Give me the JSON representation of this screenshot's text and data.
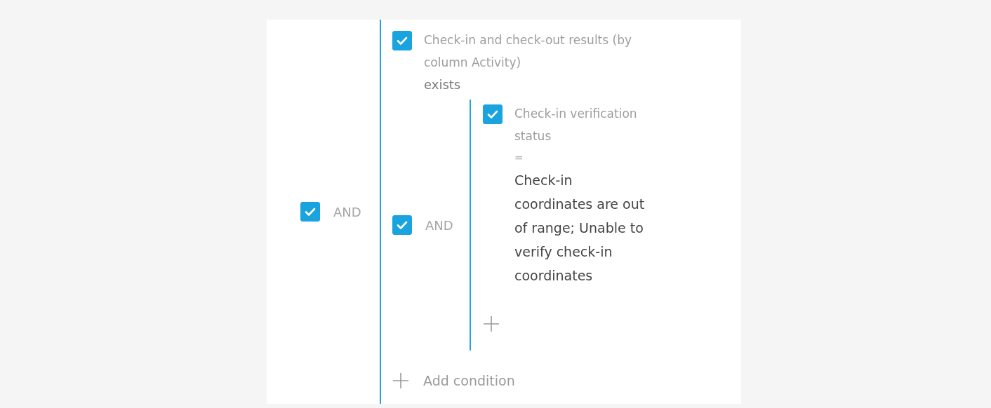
{
  "filter": {
    "checked": true,
    "operator": "AND",
    "add_label": "Add condition",
    "items": [
      {
        "kind": "condition",
        "checked": true,
        "column": "Check-in and check-out results (by column Activity)",
        "comparison": "exists"
      },
      {
        "kind": "group",
        "checked": true,
        "operator": "AND",
        "items": [
          {
            "kind": "condition",
            "checked": true,
            "column": "Check-in verification status",
            "comparison": "=",
            "value": "Check-in coordinates are out of range; Unable to verify check-in coordinates"
          }
        ]
      }
    ]
  }
}
